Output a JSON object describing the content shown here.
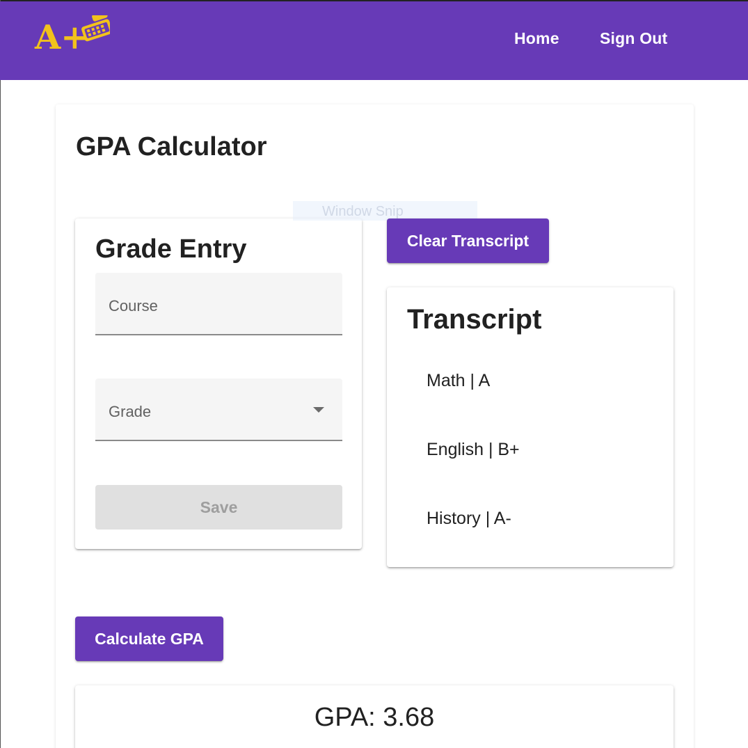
{
  "header": {
    "logo_text": "A+",
    "nav": [
      {
        "label": "Home"
      },
      {
        "label": "Sign Out"
      }
    ],
    "color": "#673ab7"
  },
  "page": {
    "title": "GPA Calculator"
  },
  "overlay": {
    "ghost_text": "Window Snip"
  },
  "grade_entry": {
    "title": "Grade Entry",
    "course_label": "Course",
    "grade_label": "Grade",
    "save_label": "Save"
  },
  "actions": {
    "clear_label": "Clear Transcript",
    "calculate_label": "Calculate GPA"
  },
  "transcript": {
    "title": "Transcript",
    "items": [
      {
        "text": "Math | A"
      },
      {
        "text": "English | B+"
      },
      {
        "text": "History | A-"
      }
    ]
  },
  "result": {
    "gpa_label": "GPA:",
    "gpa_value": "3.68"
  }
}
